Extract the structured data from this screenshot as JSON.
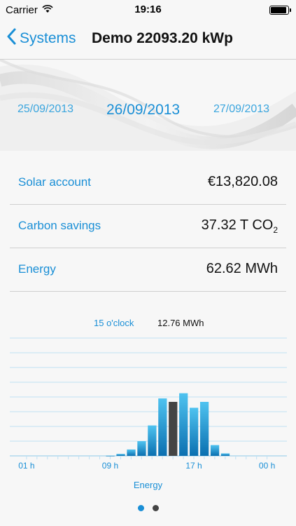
{
  "status": {
    "carrier": "Carrier",
    "time": "19:16",
    "battery_level": 0.95
  },
  "nav": {
    "back_label": "Systems",
    "title": "Demo 22093.20 kWp"
  },
  "dates": {
    "previous": "25/09/2013",
    "current": "26/09/2013",
    "next": "27/09/2013"
  },
  "stats": {
    "solar_account": {
      "label": "Solar account",
      "value": "€13,820.08"
    },
    "carbon_savings": {
      "label": "Carbon savings",
      "value": "37.32 T CO",
      "unit_subscript": "2"
    },
    "energy": {
      "label": "Energy",
      "value": "62.62 MWh"
    }
  },
  "chart_readout": {
    "hour": "15 o'clock",
    "value": "12.76 MWh"
  },
  "chart_caption": "Energy",
  "pager": {
    "page_count": 2,
    "active_index": 0
  },
  "colors": {
    "accent": "#1a8fd6",
    "bar_light": "#4fc3f0",
    "bar_dark": "#0a6fb0",
    "bar_selected": "#444444"
  },
  "chart_data": {
    "type": "bar",
    "hours": [
      1,
      2,
      3,
      4,
      5,
      6,
      7,
      8,
      9,
      10,
      11,
      12,
      13,
      14,
      15,
      16,
      17,
      18,
      19,
      20,
      21,
      22,
      23,
      24
    ],
    "values": [
      0,
      0,
      0,
      0,
      0,
      0,
      0,
      0,
      0.05,
      0.4,
      1.3,
      3.0,
      6.2,
      11.7,
      11.0,
      12.76,
      9.8,
      11.0,
      2.2,
      0.5,
      0,
      0,
      0,
      0
    ],
    "selected_hour": 15,
    "x_tick_labels": [
      {
        "hour": 1,
        "label": "01 h"
      },
      {
        "hour": 9,
        "label": "09 h"
      },
      {
        "hour": 17,
        "label": "17 h"
      },
      {
        "hour": 24,
        "label": "00 h"
      }
    ],
    "ylim": [
      0,
      24
    ],
    "grid_lines": 8,
    "xlabel": "Energy"
  }
}
